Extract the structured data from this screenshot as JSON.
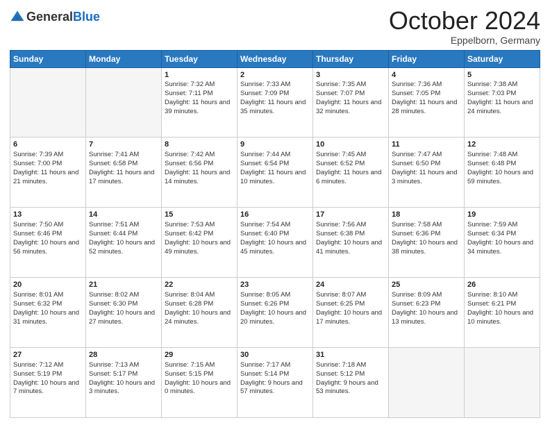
{
  "header": {
    "logo_general": "General",
    "logo_blue": "Blue",
    "month_title": "October 2024",
    "location": "Eppelborn, Germany"
  },
  "weekdays": [
    "Sunday",
    "Monday",
    "Tuesday",
    "Wednesday",
    "Thursday",
    "Friday",
    "Saturday"
  ],
  "weeks": [
    [
      {
        "day": "",
        "empty": true
      },
      {
        "day": "",
        "empty": true
      },
      {
        "day": "1",
        "sunrise": "Sunrise: 7:32 AM",
        "sunset": "Sunset: 7:11 PM",
        "daylight": "Daylight: 11 hours and 39 minutes."
      },
      {
        "day": "2",
        "sunrise": "Sunrise: 7:33 AM",
        "sunset": "Sunset: 7:09 PM",
        "daylight": "Daylight: 11 hours and 35 minutes."
      },
      {
        "day": "3",
        "sunrise": "Sunrise: 7:35 AM",
        "sunset": "Sunset: 7:07 PM",
        "daylight": "Daylight: 11 hours and 32 minutes."
      },
      {
        "day": "4",
        "sunrise": "Sunrise: 7:36 AM",
        "sunset": "Sunset: 7:05 PM",
        "daylight": "Daylight: 11 hours and 28 minutes."
      },
      {
        "day": "5",
        "sunrise": "Sunrise: 7:38 AM",
        "sunset": "Sunset: 7:03 PM",
        "daylight": "Daylight: 11 hours and 24 minutes."
      }
    ],
    [
      {
        "day": "6",
        "sunrise": "Sunrise: 7:39 AM",
        "sunset": "Sunset: 7:00 PM",
        "daylight": "Daylight: 11 hours and 21 minutes."
      },
      {
        "day": "7",
        "sunrise": "Sunrise: 7:41 AM",
        "sunset": "Sunset: 6:58 PM",
        "daylight": "Daylight: 11 hours and 17 minutes."
      },
      {
        "day": "8",
        "sunrise": "Sunrise: 7:42 AM",
        "sunset": "Sunset: 6:56 PM",
        "daylight": "Daylight: 11 hours and 14 minutes."
      },
      {
        "day": "9",
        "sunrise": "Sunrise: 7:44 AM",
        "sunset": "Sunset: 6:54 PM",
        "daylight": "Daylight: 11 hours and 10 minutes."
      },
      {
        "day": "10",
        "sunrise": "Sunrise: 7:45 AM",
        "sunset": "Sunset: 6:52 PM",
        "daylight": "Daylight: 11 hours and 6 minutes."
      },
      {
        "day": "11",
        "sunrise": "Sunrise: 7:47 AM",
        "sunset": "Sunset: 6:50 PM",
        "daylight": "Daylight: 11 hours and 3 minutes."
      },
      {
        "day": "12",
        "sunrise": "Sunrise: 7:48 AM",
        "sunset": "Sunset: 6:48 PM",
        "daylight": "Daylight: 10 hours and 59 minutes."
      }
    ],
    [
      {
        "day": "13",
        "sunrise": "Sunrise: 7:50 AM",
        "sunset": "Sunset: 6:46 PM",
        "daylight": "Daylight: 10 hours and 56 minutes."
      },
      {
        "day": "14",
        "sunrise": "Sunrise: 7:51 AM",
        "sunset": "Sunset: 6:44 PM",
        "daylight": "Daylight: 10 hours and 52 minutes."
      },
      {
        "day": "15",
        "sunrise": "Sunrise: 7:53 AM",
        "sunset": "Sunset: 6:42 PM",
        "daylight": "Daylight: 10 hours and 49 minutes."
      },
      {
        "day": "16",
        "sunrise": "Sunrise: 7:54 AM",
        "sunset": "Sunset: 6:40 PM",
        "daylight": "Daylight: 10 hours and 45 minutes."
      },
      {
        "day": "17",
        "sunrise": "Sunrise: 7:56 AM",
        "sunset": "Sunset: 6:38 PM",
        "daylight": "Daylight: 10 hours and 41 minutes."
      },
      {
        "day": "18",
        "sunrise": "Sunrise: 7:58 AM",
        "sunset": "Sunset: 6:36 PM",
        "daylight": "Daylight: 10 hours and 38 minutes."
      },
      {
        "day": "19",
        "sunrise": "Sunrise: 7:59 AM",
        "sunset": "Sunset: 6:34 PM",
        "daylight": "Daylight: 10 hours and 34 minutes."
      }
    ],
    [
      {
        "day": "20",
        "sunrise": "Sunrise: 8:01 AM",
        "sunset": "Sunset: 6:32 PM",
        "daylight": "Daylight: 10 hours and 31 minutes."
      },
      {
        "day": "21",
        "sunrise": "Sunrise: 8:02 AM",
        "sunset": "Sunset: 6:30 PM",
        "daylight": "Daylight: 10 hours and 27 minutes."
      },
      {
        "day": "22",
        "sunrise": "Sunrise: 8:04 AM",
        "sunset": "Sunset: 6:28 PM",
        "daylight": "Daylight: 10 hours and 24 minutes."
      },
      {
        "day": "23",
        "sunrise": "Sunrise: 8:05 AM",
        "sunset": "Sunset: 6:26 PM",
        "daylight": "Daylight: 10 hours and 20 minutes."
      },
      {
        "day": "24",
        "sunrise": "Sunrise: 8:07 AM",
        "sunset": "Sunset: 6:25 PM",
        "daylight": "Daylight: 10 hours and 17 minutes."
      },
      {
        "day": "25",
        "sunrise": "Sunrise: 8:09 AM",
        "sunset": "Sunset: 6:23 PM",
        "daylight": "Daylight: 10 hours and 13 minutes."
      },
      {
        "day": "26",
        "sunrise": "Sunrise: 8:10 AM",
        "sunset": "Sunset: 6:21 PM",
        "daylight": "Daylight: 10 hours and 10 minutes."
      }
    ],
    [
      {
        "day": "27",
        "sunrise": "Sunrise: 7:12 AM",
        "sunset": "Sunset: 5:19 PM",
        "daylight": "Daylight: 10 hours and 7 minutes."
      },
      {
        "day": "28",
        "sunrise": "Sunrise: 7:13 AM",
        "sunset": "Sunset: 5:17 PM",
        "daylight": "Daylight: 10 hours and 3 minutes."
      },
      {
        "day": "29",
        "sunrise": "Sunrise: 7:15 AM",
        "sunset": "Sunset: 5:15 PM",
        "daylight": "Daylight: 10 hours and 0 minutes."
      },
      {
        "day": "30",
        "sunrise": "Sunrise: 7:17 AM",
        "sunset": "Sunset: 5:14 PM",
        "daylight": "Daylight: 9 hours and 57 minutes."
      },
      {
        "day": "31",
        "sunrise": "Sunrise: 7:18 AM",
        "sunset": "Sunset: 5:12 PM",
        "daylight": "Daylight: 9 hours and 53 minutes."
      },
      {
        "day": "",
        "empty": true
      },
      {
        "day": "",
        "empty": true
      }
    ]
  ]
}
